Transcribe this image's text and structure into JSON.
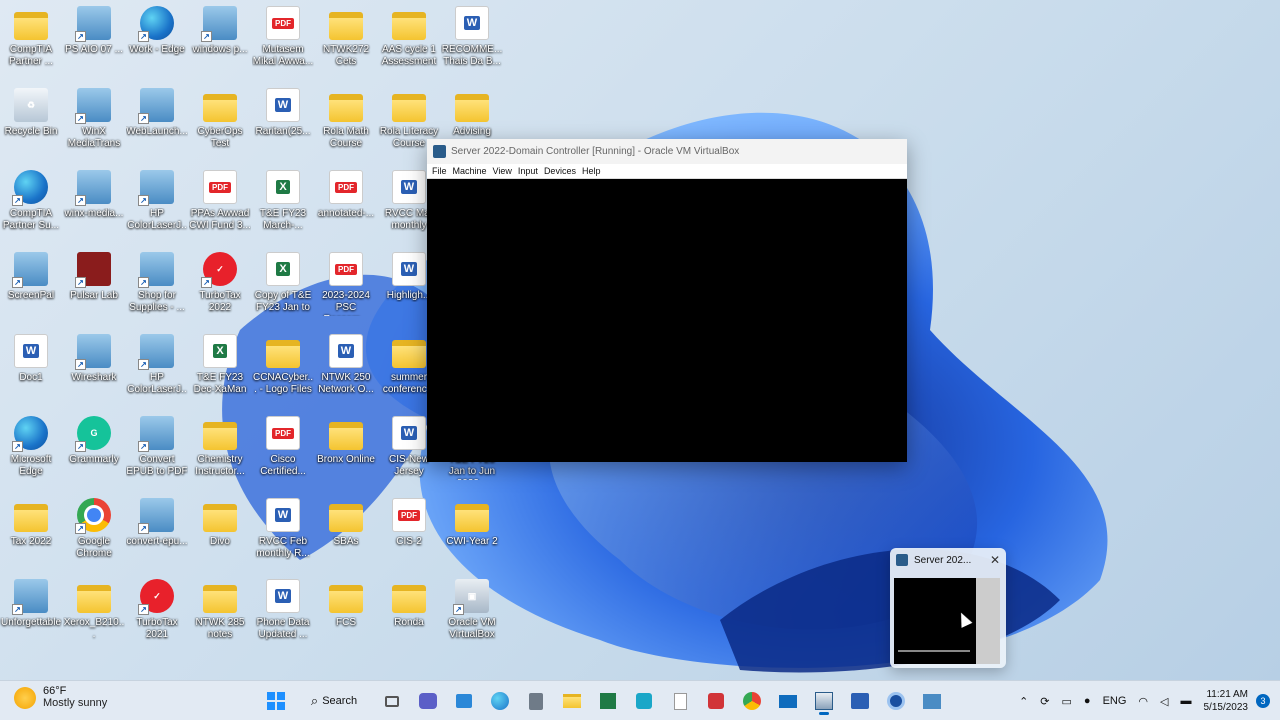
{
  "desktop_icons": [
    {
      "label": "CompTIA Partner ...",
      "glyph": "folder-icon",
      "type": "folder"
    },
    {
      "label": "PS AIO 07 ...",
      "glyph": "app-icon",
      "type": "gen"
    },
    {
      "label": "Work - Edge",
      "glyph": "edge-icon",
      "type": "edge"
    },
    {
      "label": "windows p...",
      "glyph": "film-icon",
      "type": "gen"
    },
    {
      "label": "Mutasem Mikal Awwa...",
      "glyph": "pdf-icon",
      "type": "pdf"
    },
    {
      "label": "NTWK272 Cets",
      "glyph": "folder-icon",
      "type": "folder"
    },
    {
      "label": "AAS cycle 1 Assessment",
      "glyph": "folder-icon",
      "type": "folder"
    },
    {
      "label": "RECOMME... Thais Da B...",
      "glyph": "word-icon",
      "type": "word"
    },
    {
      "label": "Recycle Bin",
      "glyph": "recycle-bin-icon",
      "type": "bin"
    },
    {
      "label": "WinX MediaTrans",
      "glyph": "winx-icon",
      "type": "gen"
    },
    {
      "label": "WebLaunch...",
      "glyph": "loading-icon",
      "type": "gen"
    },
    {
      "label": "CyberOps Test",
      "glyph": "folder-icon",
      "type": "folder"
    },
    {
      "label": "Raritan(25...",
      "glyph": "word-icon",
      "type": "word"
    },
    {
      "label": "Rola Math Course",
      "glyph": "folder-icon",
      "type": "folder"
    },
    {
      "label": "Rola Literacy Course",
      "glyph": "folder-icon",
      "type": "folder"
    },
    {
      "label": "Advising",
      "glyph": "folder-icon",
      "type": "folder"
    },
    {
      "label": "CompTIA Partner Su...",
      "glyph": "edge-icon",
      "type": "edge"
    },
    {
      "label": "winx-media...",
      "glyph": "winx-icon",
      "type": "gen"
    },
    {
      "label": "HP ColorLaserJ...",
      "glyph": "scanner-icon",
      "type": "gen"
    },
    {
      "label": "PPAs Awwad CWI Fund 3...",
      "glyph": "pdf-icon",
      "type": "pdf"
    },
    {
      "label": "T&E FY23 March-...",
      "glyph": "excel-icon",
      "type": "excel"
    },
    {
      "label": "annotated-...",
      "glyph": "pdf-icon",
      "type": "pdf"
    },
    {
      "label": "RVCC Mar monthly",
      "glyph": "word-icon",
      "type": "word"
    },
    {
      "label": "ScreenPal",
      "glyph": "screenpal-icon",
      "type": "gen"
    },
    {
      "label": "Pulsar Lab",
      "glyph": "pulsar-icon",
      "type": "dark"
    },
    {
      "label": "Shop for Supplies - ...",
      "glyph": "printer-icon",
      "type": "gen"
    },
    {
      "label": "TurboTax 2022",
      "glyph": "check-icon",
      "type": "check"
    },
    {
      "label": "Copy of T&E FY23 Jan to ...",
      "glyph": "excel-icon",
      "type": "excel"
    },
    {
      "label": "2023-2024 PSC Reccom...",
      "glyph": "pdf-icon",
      "type": "pdf"
    },
    {
      "label": "Highligh...",
      "glyph": "word-icon",
      "type": "word"
    },
    {
      "label": "Doc1",
      "glyph": "word-icon",
      "type": "word"
    },
    {
      "label": "Wireshark",
      "glyph": "wireshark-icon",
      "type": "gen"
    },
    {
      "label": "HP ColorLaserJ...",
      "glyph": "printer-icon",
      "type": "gen"
    },
    {
      "label": "T&E FY23 Dec-XaMan",
      "glyph": "excel-icon",
      "type": "excel"
    },
    {
      "label": "CCNACyber... - Logo Files",
      "glyph": "folder-icon",
      "type": "folder"
    },
    {
      "label": "NTWK 250 Network O...",
      "glyph": "word-icon",
      "type": "word"
    },
    {
      "label": "summer conferenc...",
      "glyph": "folder-icon",
      "type": "folder"
    },
    {
      "label": "Microsoft Edge",
      "glyph": "edge-icon",
      "type": "edge"
    },
    {
      "label": "Grammarly",
      "glyph": "grammarly-icon",
      "type": "green"
    },
    {
      "label": "Convert EPUB to PDF",
      "glyph": "epub-icon",
      "type": "gen"
    },
    {
      "label": "Chemistry Instructor...",
      "glyph": "folder-icon",
      "type": "folder"
    },
    {
      "label": "Cisco Certified...",
      "glyph": "pdf-icon",
      "type": "pdf"
    },
    {
      "label": "Bronx Online",
      "glyph": "folder-icon",
      "type": "folder"
    },
    {
      "label": "CIS-New Jersey",
      "glyph": "word-icon",
      "type": "word"
    },
    {
      "label": "T&E FY23 Jan to Jun 2023...",
      "glyph": "excel-icon",
      "type": "excel"
    },
    {
      "label": "Tax 2022",
      "glyph": "folder-icon",
      "type": "folder"
    },
    {
      "label": "Google Chrome",
      "glyph": "chrome-icon",
      "type": "chrome"
    },
    {
      "label": "convert-epu...",
      "glyph": "convert-icon",
      "type": "gen"
    },
    {
      "label": "Divo",
      "glyph": "folder-icon",
      "type": "folder"
    },
    {
      "label": "RVCC Feb monthly R...",
      "glyph": "word-icon",
      "type": "word"
    },
    {
      "label": "SBAs",
      "glyph": "folder-icon",
      "type": "folder"
    },
    {
      "label": "CIS-2",
      "glyph": "pdf-icon",
      "type": "pdf"
    },
    {
      "label": "CWI-Year 2",
      "glyph": "folder-icon",
      "type": "folder"
    },
    {
      "label": "Unforgettable",
      "glyph": "plant-icon",
      "type": "gen"
    },
    {
      "label": "Xerox_B210...",
      "glyph": "folder-icon",
      "type": "folder"
    },
    {
      "label": "TurboTax 2021",
      "glyph": "check-icon",
      "type": "check"
    },
    {
      "label": "NTWK 285 notes",
      "glyph": "folder-icon",
      "type": "folder"
    },
    {
      "label": "Phone Data Updated ...",
      "glyph": "word-icon",
      "type": "word"
    },
    {
      "label": "FCS",
      "glyph": "folder-icon",
      "type": "folder"
    },
    {
      "label": "Ronda",
      "glyph": "folder-icon",
      "type": "folder"
    },
    {
      "label": "Oracle VM VirtualBox",
      "glyph": "virtualbox-icon",
      "type": "vbox"
    }
  ],
  "vm_window": {
    "title": "Server 2022-Domain Controller [Running] - Oracle VM VirtualBox",
    "menu": [
      "File",
      "Machine",
      "View",
      "Input",
      "Devices",
      "Help"
    ]
  },
  "thumbnail": {
    "title": "Server 202...",
    "close": "✕"
  },
  "taskbar": {
    "weather_temp": "66°F",
    "weather_desc": "Mostly sunny",
    "search_label": "Search",
    "tray_lang": "ENG",
    "time": "11:21 AM",
    "date": "5/15/2023",
    "notification_count": "3"
  }
}
